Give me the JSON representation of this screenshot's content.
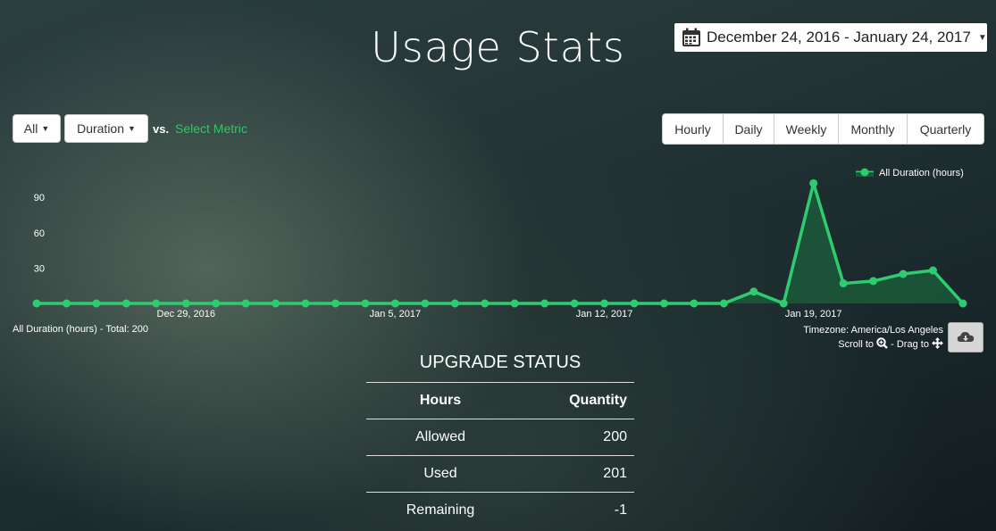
{
  "page": {
    "title": "Usage Stats"
  },
  "date_range": {
    "label": "December 24, 2016 - January 24, 2017"
  },
  "filters": {
    "all_label": "All",
    "duration_label": "Duration",
    "vs_label": "vs.",
    "metric_link": "Select Metric"
  },
  "granularity": [
    {
      "label": "Hourly",
      "active": false
    },
    {
      "label": "Daily",
      "active": true
    },
    {
      "label": "Weekly",
      "active": false
    },
    {
      "label": "Monthly",
      "active": false
    },
    {
      "label": "Quarterly",
      "active": false
    }
  ],
  "chart_data": {
    "type": "area",
    "x": [
      "2016-12-24",
      "2016-12-25",
      "2016-12-26",
      "2016-12-27",
      "2016-12-28",
      "2016-12-29",
      "2016-12-30",
      "2016-12-31",
      "2017-01-01",
      "2017-01-02",
      "2017-01-03",
      "2017-01-04",
      "2017-01-05",
      "2017-01-06",
      "2017-01-07",
      "2017-01-08",
      "2017-01-09",
      "2017-01-10",
      "2017-01-11",
      "2017-01-12",
      "2017-01-13",
      "2017-01-14",
      "2017-01-15",
      "2017-01-16",
      "2017-01-17",
      "2017-01-18",
      "2017-01-19",
      "2017-01-20",
      "2017-01-21",
      "2017-01-22",
      "2017-01-23",
      "2017-01-24"
    ],
    "x_ticks": [
      {
        "date": "2016-12-29",
        "label": "Dec 29, 2016"
      },
      {
        "date": "2017-01-05",
        "label": "Jan 5, 2017"
      },
      {
        "date": "2017-01-12",
        "label": "Jan 12, 2017"
      },
      {
        "date": "2017-01-19",
        "label": "Jan 19, 2017"
      }
    ],
    "y_ticks": [
      30,
      60,
      90
    ],
    "ylim": [
      0,
      105
    ],
    "series": [
      {
        "name": "All Duration (hours)",
        "values": [
          0,
          0,
          0,
          0,
          0,
          0,
          0,
          0,
          0,
          0,
          0,
          0,
          0,
          0,
          0,
          0,
          0,
          0,
          0,
          0,
          0,
          0,
          0,
          0,
          10,
          0,
          102,
          17,
          19,
          25,
          28,
          0
        ]
      }
    ],
    "line_color": "#2ecc71",
    "fill_color": "#1c5a3a",
    "legend": "top-right",
    "grid": false
  },
  "chart_footer": {
    "summary": "All Duration (hours) - Total: 200",
    "timezone": "Timezone: America/Los Angeles",
    "scroll_text": "Scroll to",
    "drag_text": "- Drag to"
  },
  "upgrade": {
    "title": "UPGRADE STATUS",
    "headers": [
      "Hours",
      "Quantity"
    ],
    "rows": [
      [
        "Allowed",
        "200"
      ],
      [
        "Used",
        "201"
      ],
      [
        "Remaining",
        "-1"
      ]
    ]
  }
}
